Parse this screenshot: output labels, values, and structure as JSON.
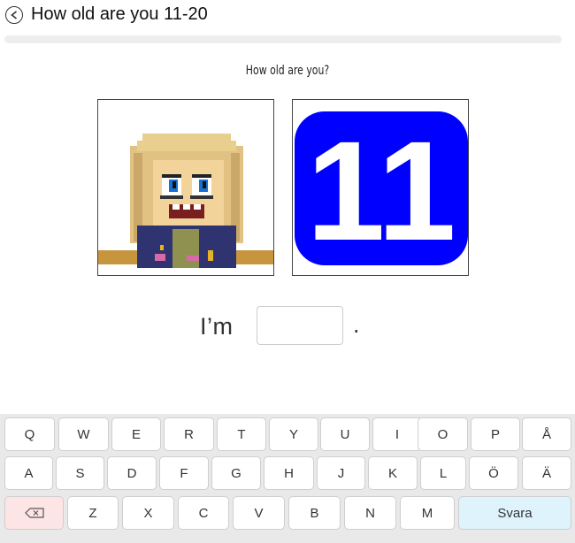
{
  "header": {
    "title": "How old are you 11-20",
    "back_icon": "back-arrow-icon"
  },
  "progress": {
    "value": 0
  },
  "question": "How old are you?",
  "images": {
    "left": {
      "icon": "character-portrait"
    },
    "right": {
      "number": "11",
      "bg_color": "#0000ff"
    }
  },
  "answer": {
    "prefix": "I’m",
    "value": "",
    "suffix": "."
  },
  "keyboard": {
    "row1": [
      "Q",
      "W",
      "E",
      "R",
      "T",
      "Y",
      "U",
      "I",
      "O",
      "P",
      "Å"
    ],
    "row2": [
      "A",
      "S",
      "D",
      "F",
      "G",
      "H",
      "J",
      "K",
      "L",
      "Ö",
      "Ä"
    ],
    "row3": [
      "Z",
      "X",
      "C",
      "V",
      "B",
      "N",
      "M"
    ],
    "backspace_icon": "backspace-icon",
    "submit_label": "Svara",
    "colors": {
      "backspace_bg": "#fde5e5",
      "submit_bg": "#def3fb"
    }
  }
}
